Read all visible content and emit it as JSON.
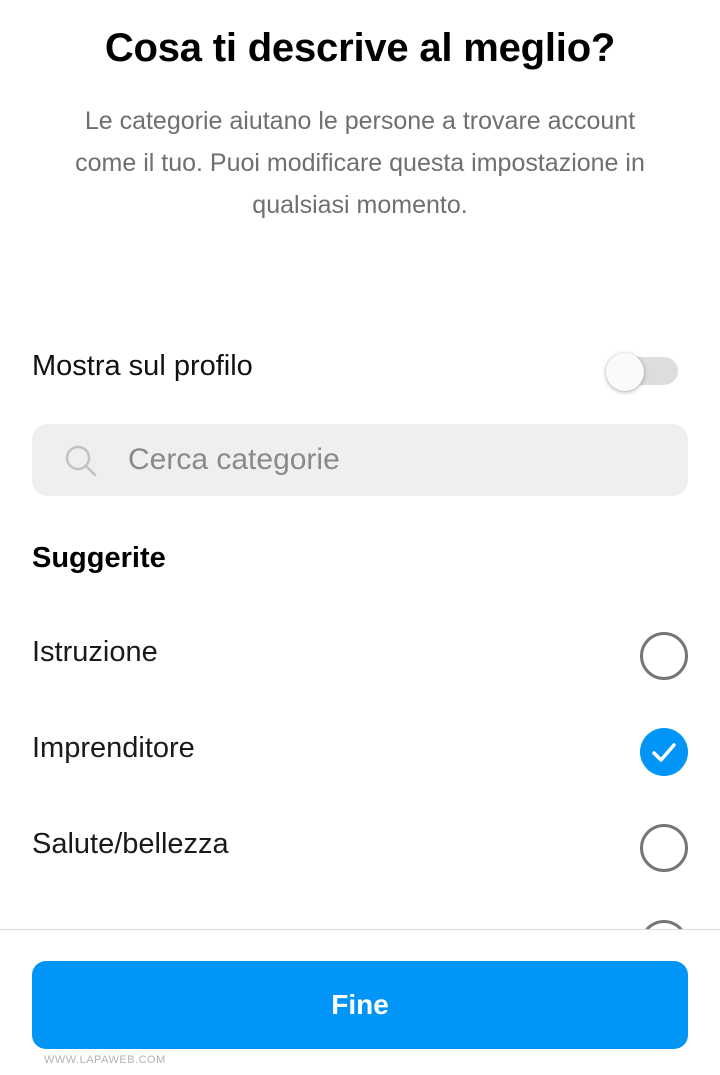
{
  "header": {
    "title": "Cosa ti descrive al meglio?",
    "subtitle": "Le categorie aiutano le persone a trovare account come il tuo. Puoi modificare questa impostazione in qualsiasi momento."
  },
  "display_toggle": {
    "label": "Mostra sul profilo",
    "enabled": false
  },
  "search": {
    "placeholder": "Cerca categorie",
    "value": "",
    "icon": "search-icon"
  },
  "suggested": {
    "heading": "Suggerite",
    "items": [
      {
        "label": "Istruzione",
        "selected": false
      },
      {
        "label": "Imprenditore",
        "selected": true
      },
      {
        "label": "Salute/bellezza",
        "selected": false
      },
      {
        "label": "",
        "selected": false
      }
    ]
  },
  "footer": {
    "done_label": "Fine"
  },
  "watermark": "WWW.LAPAWEB.COM",
  "colors": {
    "accent": "#0095f6",
    "text_secondary": "#6f6f6f",
    "search_bg": "#efefef",
    "radio_border": "#757575"
  }
}
